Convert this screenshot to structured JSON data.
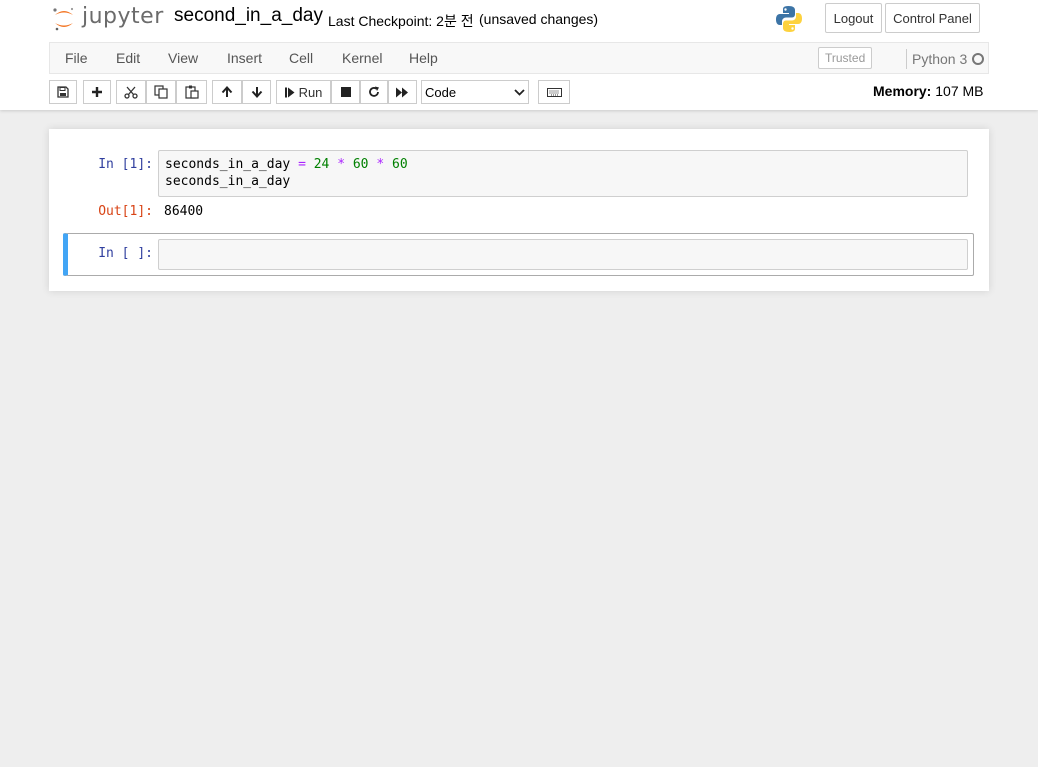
{
  "header": {
    "logo_text": "jupyter",
    "notebook_name": "second_in_a_day",
    "last_checkpoint": "Last Checkpoint: 2분 전",
    "autosave_status": "(unsaved changes)",
    "logout_label": "Logout",
    "control_panel_label": "Control Panel"
  },
  "menubar": {
    "items": [
      "File",
      "Edit",
      "View",
      "Insert",
      "Cell",
      "Kernel",
      "Help"
    ],
    "trusted_label": "Trusted",
    "kernel_name": "Python 3"
  },
  "toolbar": {
    "run_label": "Run",
    "cell_type": "Code",
    "memory_label": "Memory:",
    "memory_value": "107 MB",
    "icons": [
      "save-icon",
      "plus-icon",
      "cut-icon",
      "copy-icon",
      "paste-icon",
      "arrow-up-icon",
      "arrow-down-icon",
      "step-forward-icon",
      "stop-icon",
      "restart-icon",
      "fast-forward-icon",
      "keyboard-icon"
    ]
  },
  "cells": [
    {
      "in_prompt": "In [1]:",
      "code_line1": {
        "var": "seconds_in_a_day",
        "eq": "=",
        "n1": "24",
        "op1": "*",
        "n2": "60",
        "op2": "*",
        "n3": "60"
      },
      "code_line2": "seconds_in_a_day",
      "out_prompt": "Out[1]:",
      "output": "86400"
    },
    {
      "in_prompt": "In [ ]:",
      "code": ""
    }
  ],
  "colors": {
    "selected_cell_border": "#42a5f5",
    "in_prompt": "#303f9f",
    "out_prompt": "#d84315",
    "code_number": "#008000",
    "code_operator": "#aa22ff"
  }
}
